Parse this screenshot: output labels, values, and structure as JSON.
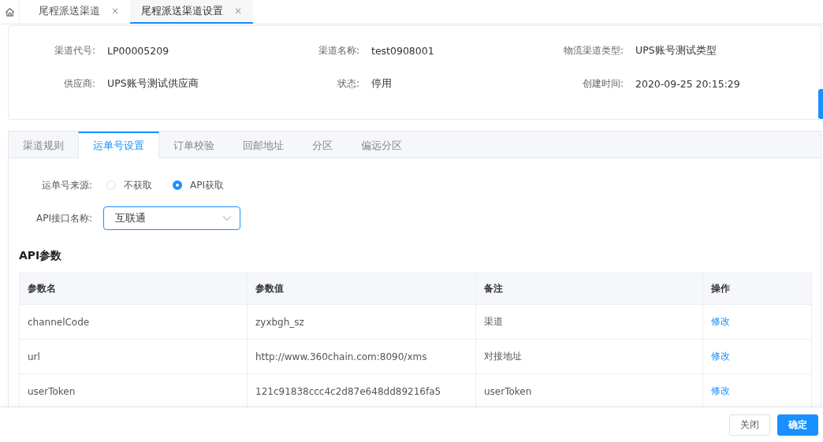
{
  "page_tabs": [
    {
      "label": "尾程派送渠道",
      "close": "×",
      "selected": false
    },
    {
      "label": "尾程派送渠道设置",
      "close": "×",
      "selected": true
    }
  ],
  "info": [
    {
      "label": "渠道代号:",
      "value": "LP00005209"
    },
    {
      "label": "渠道名称:",
      "value": "test0908001"
    },
    {
      "label": "物流渠道类型:",
      "value": "UPS账号测试类型"
    },
    {
      "label": "供应商:",
      "value": "UPS账号测试供应商"
    },
    {
      "label": "状态:",
      "value": "停用"
    },
    {
      "label": "创建时间:",
      "value": "2020-09-25 20:15:29"
    }
  ],
  "detail_tabs": [
    {
      "label": "渠道规则",
      "selected": false
    },
    {
      "label": "运单号设置",
      "selected": true
    },
    {
      "label": "订单校验",
      "selected": false
    },
    {
      "label": "回邮地址",
      "selected": false
    },
    {
      "label": "分区",
      "selected": false
    },
    {
      "label": "偏远分区",
      "selected": false
    }
  ],
  "source": {
    "label": "运单号来源:",
    "options": [
      {
        "label": "不获取",
        "selected": false
      },
      {
        "label": "API获取",
        "selected": true
      }
    ]
  },
  "api_select": {
    "label": "API接口名称:",
    "value": "互联通"
  },
  "section_title": "API参数",
  "table": {
    "columns": [
      "参数名",
      "参数值",
      "备注",
      "操作"
    ],
    "rows": [
      {
        "name": "channelCode",
        "value": "zyxbgh_sz",
        "note": "渠道",
        "action": "修改"
      },
      {
        "name": "url",
        "value": "http://www.360chain.com:8090/xms",
        "note": "对接地址",
        "action": "修改"
      },
      {
        "name": "userToken",
        "value": "121c91838ccc4c2d87e648dd89216fa5",
        "note": "userToken",
        "action": "修改"
      }
    ]
  },
  "buttons": [
    {
      "label": "关闭",
      "kind": "default"
    },
    {
      "label": "确定",
      "kind": "primary"
    }
  ]
}
